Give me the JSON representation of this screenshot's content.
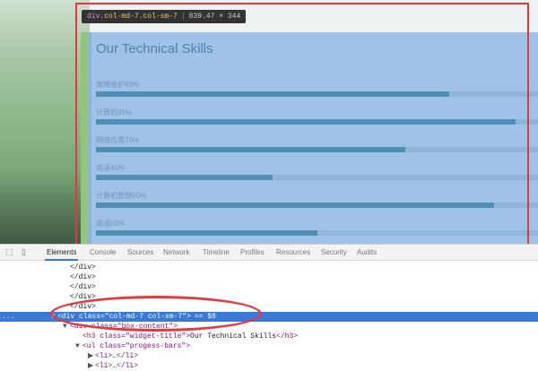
{
  "tooltip": {
    "tag": "div",
    "classes": ".col-md-7.col-sm-7",
    "dimensions": "839.47 × 344"
  },
  "content": {
    "heading": "Our Technical Skills",
    "skills": [
      {
        "label": "故障维护80%",
        "percent": 80
      },
      {
        "label": "计算机95%",
        "percent": 95
      },
      {
        "label": "网络应用70%",
        "percent": 70
      },
      {
        "label": "英语40%",
        "percent": 40
      },
      {
        "label": "计算机管理90%",
        "percent": 90
      },
      {
        "label": "英语50%",
        "percent": 50
      }
    ]
  },
  "devtools": {
    "tabs": [
      "Elements",
      "Console",
      "Sources",
      "Network",
      "Timeline",
      "Profiles",
      "Resources",
      "Security",
      "Audits"
    ],
    "active_tab": "Elements",
    "lines": [
      {
        "indent": 10,
        "text": "</div>"
      },
      {
        "indent": 10,
        "text": "</div>"
      },
      {
        "indent": 10,
        "text": "</div>"
      },
      {
        "indent": 10,
        "text": "</div>"
      },
      {
        "indent": 10,
        "text": "</div>"
      },
      {
        "indent": 8,
        "tri": "▼",
        "open": "<div class=\"col-md-7 col-sm-7\">",
        "extra": "== $0",
        "selected": true
      },
      {
        "indent": 10,
        "tri": "▼",
        "open": "<div class=\"box-content\">"
      },
      {
        "indent": 12,
        "open": "<h3 class=\"widget-title\">",
        "text": "Our Technical Skills",
        "close": "</h3>"
      },
      {
        "indent": 12,
        "tri": "▼",
        "open": "<ul class=\"progess-bars\">"
      },
      {
        "indent": 14,
        "tri": "▶",
        "open": "<li>",
        "text": "…",
        "close": "</li>"
      },
      {
        "indent": 14,
        "tri": "▶",
        "open": "<li>",
        "text": "…",
        "close": "</li>"
      }
    ]
  },
  "colors": {
    "highlight": "#9fc3e7",
    "annotation": "#e23a3a",
    "selection": "#3879d9"
  }
}
